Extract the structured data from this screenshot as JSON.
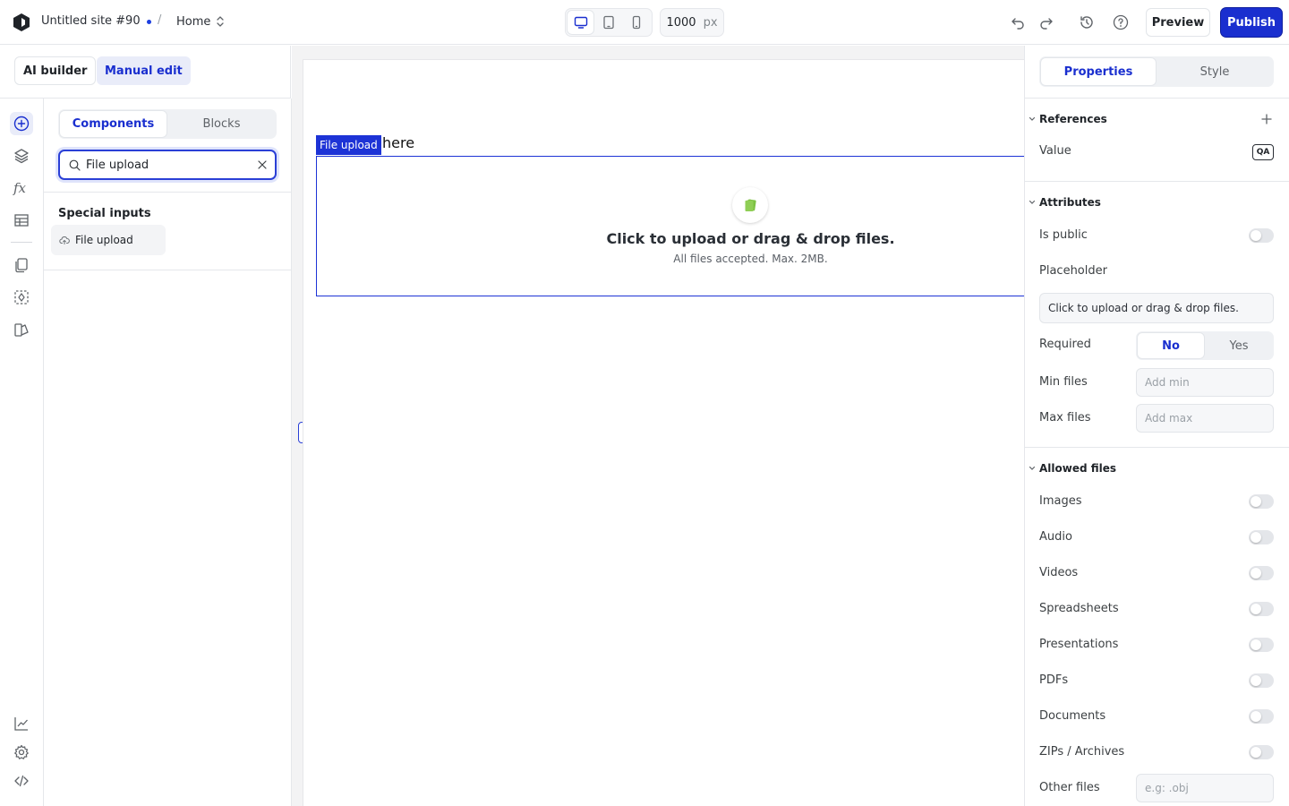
{
  "topbar": {
    "site_name": "Untitled site #90",
    "separator": "/",
    "page": "Home",
    "width_value": "1000",
    "width_unit": "px",
    "preview_label": "Preview",
    "publish_label": "Publish",
    "active_device": "desktop"
  },
  "mode": {
    "ai_label": "AI builder",
    "manual_label": "Manual edit",
    "active": "manual"
  },
  "left_panel": {
    "tabs": [
      "Components",
      "Blocks"
    ],
    "active_tab": "Components",
    "search_value": "File upload",
    "section_title": "Special inputs",
    "items": [
      {
        "label": "File upload",
        "icon": "cloud-upload-icon"
      }
    ]
  },
  "canvas": {
    "selection_tag": "File upload",
    "here_text": "here",
    "upload_title": "Click to upload or drag & drop files.",
    "upload_subtitle": "All files accepted. Max. 2MB."
  },
  "right_panel": {
    "tabs": [
      "Properties",
      "Style"
    ],
    "active_tab": "Properties",
    "references": {
      "title": "References",
      "value_label": "Value",
      "badge": "QA"
    },
    "attributes": {
      "title": "Attributes",
      "is_public_label": "Is public",
      "is_public": false,
      "placeholder_label": "Placeholder",
      "placeholder_value": "Click to upload or drag & drop files.",
      "required_label": "Required",
      "required_options": [
        "No",
        "Yes"
      ],
      "required_selected": "No",
      "min_files_label": "Min files",
      "min_files_placeholder": "Add min",
      "max_files_label": "Max files",
      "max_files_placeholder": "Add max"
    },
    "allowed_files": {
      "title": "Allowed files",
      "types": [
        {
          "label": "Images",
          "enabled": false
        },
        {
          "label": "Audio",
          "enabled": false
        },
        {
          "label": "Videos",
          "enabled": false
        },
        {
          "label": "Spreadsheets",
          "enabled": false
        },
        {
          "label": "Presentations",
          "enabled": false
        },
        {
          "label": "PDFs",
          "enabled": false
        },
        {
          "label": "Documents",
          "enabled": false
        },
        {
          "label": "ZIPs / Archives",
          "enabled": false
        }
      ],
      "other_label": "Other files",
      "other_placeholder": "e.g: .obj"
    }
  },
  "colors": {
    "accent": "#1a2fcf",
    "accent_soft": "#e9ecf9",
    "upload_icon": "#7cc243"
  }
}
